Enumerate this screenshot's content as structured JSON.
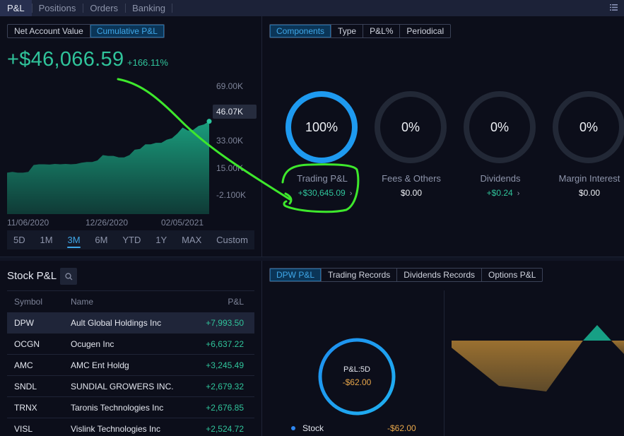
{
  "top_nav": {
    "tabs": [
      "P&L",
      "Positions",
      "Orders",
      "Banking"
    ],
    "active_tab": "P&L",
    "menu_icon": "list-icon"
  },
  "account_toggle": {
    "options": [
      "Net Account Value",
      "Cumulative P&L"
    ],
    "active": "Cumulative P&L"
  },
  "summary": {
    "value": "+$46,066.59",
    "percent": "+166.11%"
  },
  "pnl_chart": {
    "y_ticks": [
      "69.00K",
      "33.00K",
      "15.00K",
      "-2.100K"
    ],
    "current_badge": "46.07K",
    "x_ticks": [
      "11/06/2020",
      "12/26/2020",
      "02/05/2021"
    ],
    "ranges": [
      "5D",
      "1M",
      "3M",
      "6M",
      "YTD",
      "1Y",
      "MAX",
      "Custom"
    ],
    "active_range": "3M",
    "fill_color": "#1a9c7c"
  },
  "chart_data": {
    "type": "area",
    "title": "Cumulative P&L",
    "xlabel": "",
    "ylabel": "",
    "x_ticks": [
      "11/06/2020",
      "12/26/2020",
      "02/05/2021"
    ],
    "y_ticks": [
      -2100,
      15000,
      33000,
      69000
    ],
    "ylim": [
      -10000,
      69000
    ],
    "series": [
      {
        "name": "Cumulative P&L",
        "values": [
          12500,
          13000,
          12500,
          12500,
          13000,
          17500,
          18000,
          18000,
          17800,
          18200,
          18000,
          18200,
          18000,
          18200,
          19000,
          19500,
          19500,
          20500,
          24000,
          23500,
          23500,
          22500,
          22500,
          24000,
          27500,
          28000,
          31000,
          31000,
          32000,
          32000,
          34000,
          35000,
          38000,
          42000,
          40000,
          40500,
          43000,
          44000,
          46070
        ]
      }
    ],
    "last_value_label": "46.07K",
    "grid": false
  },
  "components": {
    "tabs": [
      "Components",
      "Type",
      "P&L%",
      "Periodical"
    ],
    "active_tab": "Components",
    "items": [
      {
        "label": "Trading P&L",
        "pct": "100%",
        "fraction": 1.0,
        "value": "+$30,645.09",
        "positive": true,
        "has_chevron": true
      },
      {
        "label": "Fees & Others",
        "pct": "0%",
        "fraction": 0,
        "value": "$0.00",
        "positive": false,
        "has_chevron": false
      },
      {
        "label": "Dividends",
        "pct": "0%",
        "fraction": 0,
        "value": "+$0.24",
        "positive": true,
        "has_chevron": true
      },
      {
        "label": "Margin Interest",
        "pct": "0%",
        "fraction": 0,
        "value": "$0.00",
        "positive": false,
        "has_chevron": false
      }
    ],
    "ring_color": "#1e9af0",
    "track_color": "#222836"
  },
  "stock_pnl": {
    "title": "Stock P&L",
    "columns": [
      "Symbol",
      "Name",
      "P&L"
    ],
    "rows": [
      {
        "symbol": "DPW",
        "name": "Ault Global Holdings Inc",
        "pnl": "+7,993.50"
      },
      {
        "symbol": "OCGN",
        "name": "Ocugen Inc",
        "pnl": "+6,637.22"
      },
      {
        "symbol": "AMC",
        "name": "AMC Ent Holdg",
        "pnl": "+3,245.49"
      },
      {
        "symbol": "SNDL",
        "name": "SUNDIAL GROWERS INC.",
        "pnl": "+2,679.32"
      },
      {
        "symbol": "TRNX",
        "name": "Taronis Technologies Inc",
        "pnl": "+2,676.85"
      },
      {
        "symbol": "VISL",
        "name": "Vislink Technologies Inc",
        "pnl": "+2,524.72"
      }
    ],
    "selected_symbol": "DPW"
  },
  "detail": {
    "tabs": [
      "DPW P&L",
      "Trading Records",
      "Dividends Records",
      "Options P&L"
    ],
    "active_tab": "DPW P&L",
    "ring_label": "P&L:5D",
    "ring_value": "-$62.00",
    "legend": [
      {
        "label": "Stock",
        "value": "-$62.00",
        "color": "#2f87f0"
      }
    ],
    "loss_color": "#9a7030",
    "gain_color": "#17a085"
  }
}
